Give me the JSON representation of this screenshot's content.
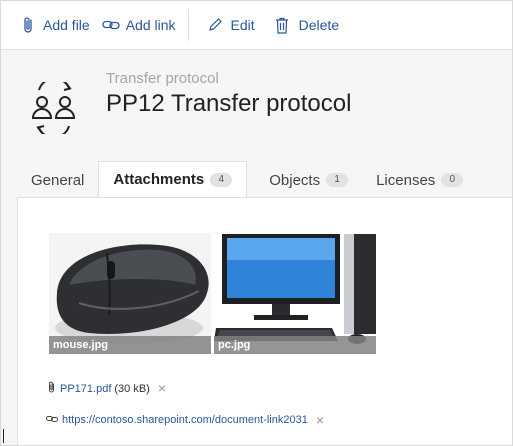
{
  "toolbar": {
    "add_file": "Add file",
    "add_link": "Add link",
    "edit": "Edit",
    "delete": "Delete"
  },
  "header": {
    "subtitle": "Transfer protocol",
    "title": "PP12 Transfer protocol"
  },
  "tabs": [
    {
      "label": "General",
      "count": null
    },
    {
      "label": "Attachments",
      "count": "4"
    },
    {
      "label": "Objects",
      "count": "1"
    },
    {
      "label": "Licenses",
      "count": "0"
    }
  ],
  "attachments": {
    "images": [
      {
        "name": "mouse.jpg"
      },
      {
        "name": "pc.jpg"
      }
    ],
    "file": {
      "name": "PP171.pdf",
      "size": "(30 kB)",
      "remove": "×"
    },
    "link": {
      "url": "https://contoso.sharepoint.com/document-link2031",
      "remove": "×"
    }
  },
  "colors": {
    "accent": "#2b579a",
    "background": "#f6f6f6",
    "panel": "#ffffff"
  }
}
